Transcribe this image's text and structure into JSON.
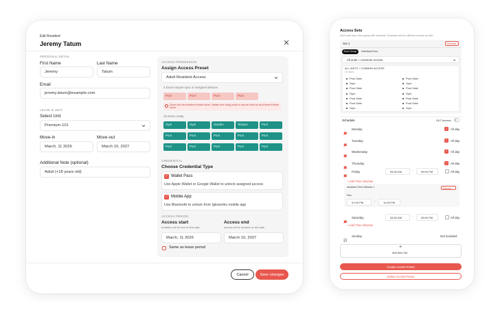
{
  "modal": {
    "heading": "Edit Resident",
    "name": "Jeremy Tatum",
    "personal_section": "PERSONAL DETAIL",
    "first_name_label": "First Name",
    "first_name_value": "Jeremy",
    "last_name_label": "Last Name",
    "last_name_value": "Tatum",
    "email_label": "Email",
    "email_value": "jeremy.tatum@example.com",
    "lease_section": "LEASE & UNIT",
    "unit_label": "Select Unit",
    "unit_value": "Premium-101",
    "move_in_label": "Move-in",
    "move_in_value": "March, 11 2026",
    "move_out_label": "Move-out",
    "move_out_value": "March 10, 2027",
    "note_label": "Additional Note (optional)",
    "note_value": "Adult (+18 years old)",
    "access_section": "ACCESS PERMISSION",
    "preset_label": "Assign Access Preset",
    "preset_value": "Adult Resident Access",
    "sync_note": "4 Doors require sync or assigned devices",
    "red_chips": [
      "Pool",
      "Pool",
      "Pool",
      "Pool"
    ],
    "warning_text": "Doors can't be enabled in these doors / details from using portal or sky are used for all of these if these doors.",
    "ready_note": "15 Doors ready",
    "green_chips": [
      "Gym",
      "Gym",
      "Garden",
      "Terrace",
      "Pool",
      "Pool",
      "Pool",
      "Pool",
      "Pool",
      "Pool",
      "Pool",
      "Pool",
      "Pool",
      "Pool",
      "Pool"
    ],
    "credential_section": "CREDENTIAL",
    "credential_label": "Choose Credential Type",
    "wallet_title": "Wallet Pass",
    "wallet_desc": "Use Apple Wallet or Google Wallet to unlock assigned access",
    "mobile_title": "Mobile App",
    "mobile_desc": "Use Bluetooth to unlock from Igloworks mobile app",
    "period_section": "ACCESS PERIOD",
    "start_label": "Access start",
    "start_sub": "Invitation will be sent on this date",
    "start_value": "March, 11 2026",
    "end_label": "Access end",
    "end_sub": "Access will be revoked on this date",
    "end_value": "March 10, 2027",
    "same_lease": "Same as lease period",
    "cancel": "Cancel",
    "save": "Save changes"
  },
  "tablet": {
    "title": "Access Sets",
    "subtitle": "Each sets has a door group with schedule. Schedule sets for different access as wish",
    "set_label": "Set 1",
    "remove": "Remove",
    "tabs": [
      "Door Group",
      "Individual Door"
    ],
    "group_select": "All units + Common Access",
    "group_header": "ALL UNITS + COMMON ACCESS",
    "group_sub": "15 doors",
    "doors_left": [
      "Pool Gate",
      "Gym",
      "Pool Gate",
      "Gym",
      "Pool Gate",
      "Pool Gate",
      "Gym"
    ],
    "doors_right": [
      "Pool Gate",
      "Gym",
      "Pool Gate",
      "Gym",
      "Pool Gate",
      "Pool Gate",
      "Gym"
    ],
    "schedule_label": "Schedule",
    "twenty_four": "24/7 Access",
    "all_day": "All day",
    "days": [
      "Monday",
      "Tuesday",
      "Wednesday",
      "Thursday"
    ],
    "friday": "Friday",
    "friday_from": "05:00 AM",
    "friday_to": "05:00 PM",
    "add_time": "Add Time Window",
    "window_name": "Assistant Time Window 1",
    "window_remove": "Remove",
    "from_label": "Flex",
    "window_from": "01:00 PM",
    "window_to": "10:00 PM",
    "saturday": "Saturday",
    "sat_from": "05:00 AM",
    "sat_to": "05:00 PM",
    "add_time_2": "Add Time Window",
    "sunday": "Sunday",
    "not_included": "Not included",
    "add_set": "Add New Set",
    "create_preset": "Create Access Preset",
    "delete_preset": "Delete Access Preset"
  },
  "colors": {
    "accent": "#e8574d",
    "teal": "#1e9287",
    "pink": "#f6c7c3"
  }
}
